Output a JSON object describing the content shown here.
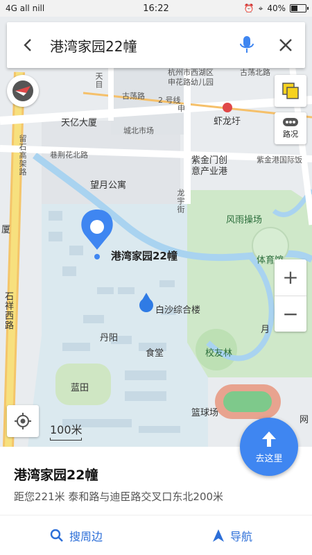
{
  "status": {
    "left": "4G  all  nill",
    "time": "16:22",
    "battery": "40%",
    "battery_level": 0.4
  },
  "search": {
    "query": "港湾家园22幢",
    "back_icon": "back-arrow-icon",
    "mic_icon": "microphone-icon",
    "clear_icon": "close-icon"
  },
  "map": {
    "labels": {
      "xihu_kindergarten_1": "杭州市西湖区",
      "xihu_kindergarten_2": "申花路幼儿园",
      "gudang_north": "古荡北路",
      "gudang_road": "古荡路",
      "road_2": "2 号线",
      "xialongyu": "虾龙圩",
      "tianyi": "天亿大厦",
      "chengbei": "城北市场",
      "gongchenqiao": "巷荆花北路",
      "zijin_1": "紫金门创",
      "zijin_2": "意产业港",
      "zijingang": "紫金港国际饭",
      "liushi": "留石高架路",
      "tianmu": "天目",
      "wangyue": "望月公寓",
      "longyu": "龙宇街",
      "fengyu": "风雨操场",
      "gym": "体育馆",
      "poi_name": "港湾家园22幢",
      "baisha": "白沙综合楼",
      "dining": "食堂",
      "xiaoyou": "校友林",
      "danyang": "丹阳",
      "lanyin": "蓝田",
      "basketball": "篮球场",
      "xiu": "厦",
      "shixiang": "石祥西路",
      "moon": "月",
      "wang": "网",
      "xin": "申"
    },
    "scale_label": "100米",
    "traffic_label": "路况",
    "accent": "#3f86f1",
    "green": "#cfe8c9"
  },
  "buttons": {
    "zoom_in": "+",
    "zoom_out": "−",
    "go_here": "去这里"
  },
  "card": {
    "title": "港湾家园22幢",
    "subtitle": "距您221米   泰和路与迪臣路交叉口东北200米",
    "nearby": "搜周边",
    "navigate": "导航"
  }
}
